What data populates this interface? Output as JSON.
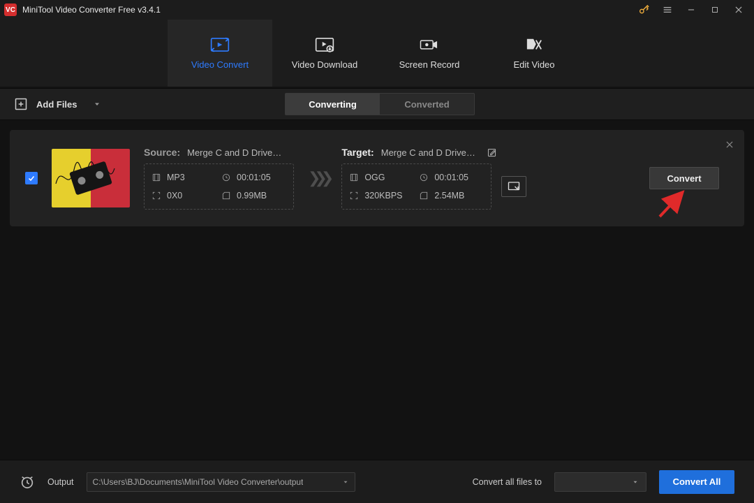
{
  "titlebar": {
    "title": "MiniTool Video Converter Free v3.4.1"
  },
  "nav": {
    "tabs": [
      {
        "label": "Video Convert"
      },
      {
        "label": "Video Download"
      },
      {
        "label": "Screen Record"
      },
      {
        "label": "Edit Video"
      }
    ]
  },
  "toolbar": {
    "add_files_label": "Add Files",
    "segments": {
      "converting": "Converting",
      "converted": "Converted"
    }
  },
  "item": {
    "source_label": "Source:",
    "target_label": "Target:",
    "source_filename": "Merge C and D Drive…",
    "target_filename": "Merge C and D Drive…",
    "source_format": "MP3",
    "source_duration": "00:01:05",
    "source_resolution": "0X0",
    "source_size": "0.99MB",
    "target_format": "OGG",
    "target_duration": "00:01:05",
    "target_bitrate": "320KBPS",
    "target_size": "2.54MB",
    "convert_label": "Convert"
  },
  "footer": {
    "output_label": "Output",
    "output_path": "C:\\Users\\BJ\\Documents\\MiniTool Video Converter\\output",
    "convert_to_label": "Convert all files to",
    "convert_all_label": "Convert All"
  }
}
